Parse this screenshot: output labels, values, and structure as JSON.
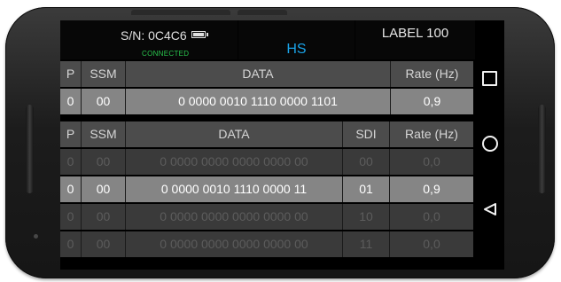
{
  "header": {
    "serial": "S/N: 0C4C6",
    "status": "CONNECTED",
    "speed": "HS",
    "label": "LABEL 100"
  },
  "table1": {
    "headers": {
      "p": "P",
      "ssm": "SSM",
      "data": "DATA",
      "rate": "Rate (Hz)"
    },
    "rows": [
      {
        "p": "0",
        "ssm": "00",
        "data": "0  0000  0010  1110  0000  1101",
        "rate": "0,9"
      }
    ]
  },
  "table2": {
    "headers": {
      "p": "P",
      "ssm": "SSM",
      "data": "DATA",
      "sdi": "SDI",
      "rate": "Rate (Hz)"
    },
    "rows": [
      {
        "p": "0",
        "ssm": "00",
        "data": "0  0000  0000  0000  0000  00",
        "sdi": "00",
        "rate": "0,0",
        "state": "inactive"
      },
      {
        "p": "0",
        "ssm": "00",
        "data": "0  0000  0010  1110  0000  11",
        "sdi": "01",
        "rate": "0,9",
        "state": "active"
      },
      {
        "p": "0",
        "ssm": "00",
        "data": "0  0000  0000  0000  0000  00",
        "sdi": "10",
        "rate": "0,0",
        "state": "inactive"
      },
      {
        "p": "0",
        "ssm": "00",
        "data": "0  0000  0000  0000  0000  00",
        "sdi": "11",
        "rate": "0,0",
        "state": "inactive"
      }
    ]
  },
  "nav": {
    "buttons": [
      "square-icon",
      "circle-icon",
      "back-triangle-icon"
    ]
  },
  "colors": {
    "header_row": "#4c4c4c",
    "active_row": "#858585",
    "inactive_row": "#3a3a3a",
    "connected": "#29c44d",
    "hs_accent": "#1aa3e8"
  }
}
